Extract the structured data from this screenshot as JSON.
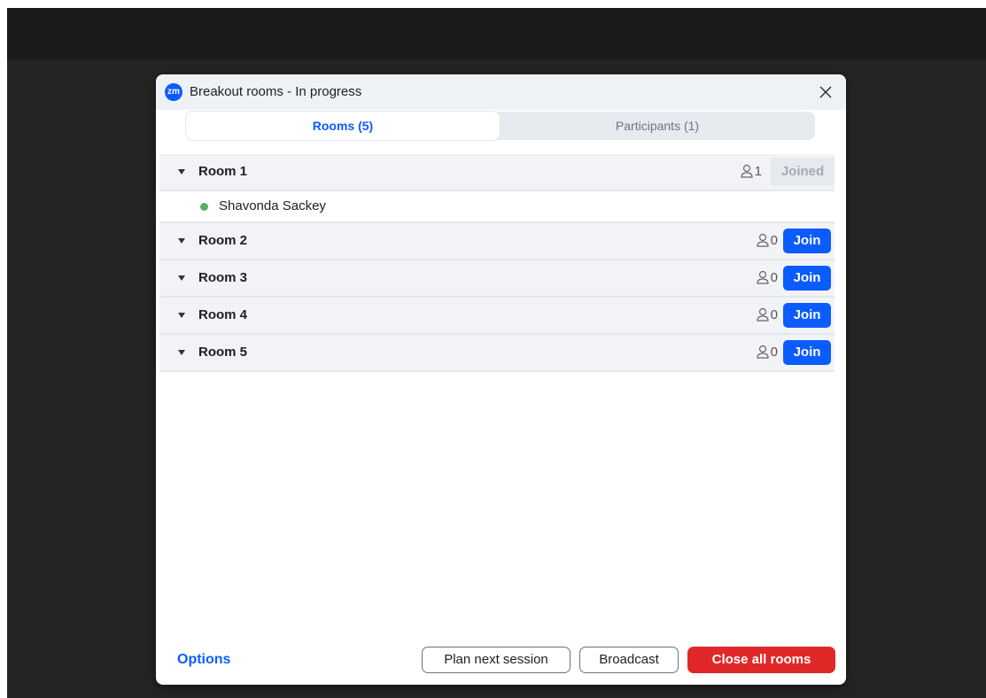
{
  "window": {
    "app_icon_text": "zm",
    "title": "Breakout rooms - In progress"
  },
  "tabs": [
    {
      "label": "Rooms (5)",
      "active": true
    },
    {
      "label": "Participants (1)",
      "active": false
    }
  ],
  "rooms": [
    {
      "name": "Room 1",
      "count": "1",
      "action": "Joined",
      "expanded": true,
      "participants": [
        {
          "name": "Shavonda Sackey",
          "status_color": "#56b05f"
        }
      ]
    },
    {
      "name": "Room 2",
      "count": "0",
      "action": "Join"
    },
    {
      "name": "Room 3",
      "count": "0",
      "action": "Join"
    },
    {
      "name": "Room 4",
      "count": "0",
      "action": "Join"
    },
    {
      "name": "Room 5",
      "count": "0",
      "action": "Join"
    }
  ],
  "footer": {
    "options_label": "Options",
    "plan_label": "Plan next session",
    "broadcast_label": "Broadcast",
    "close_all_label": "Close all rooms"
  },
  "colors": {
    "accent": "#0b5cff",
    "danger": "#e02828",
    "online": "#56b05f"
  },
  "icons": {
    "close": "close-icon",
    "person": "person-icon",
    "caret": "caret-down-icon"
  }
}
